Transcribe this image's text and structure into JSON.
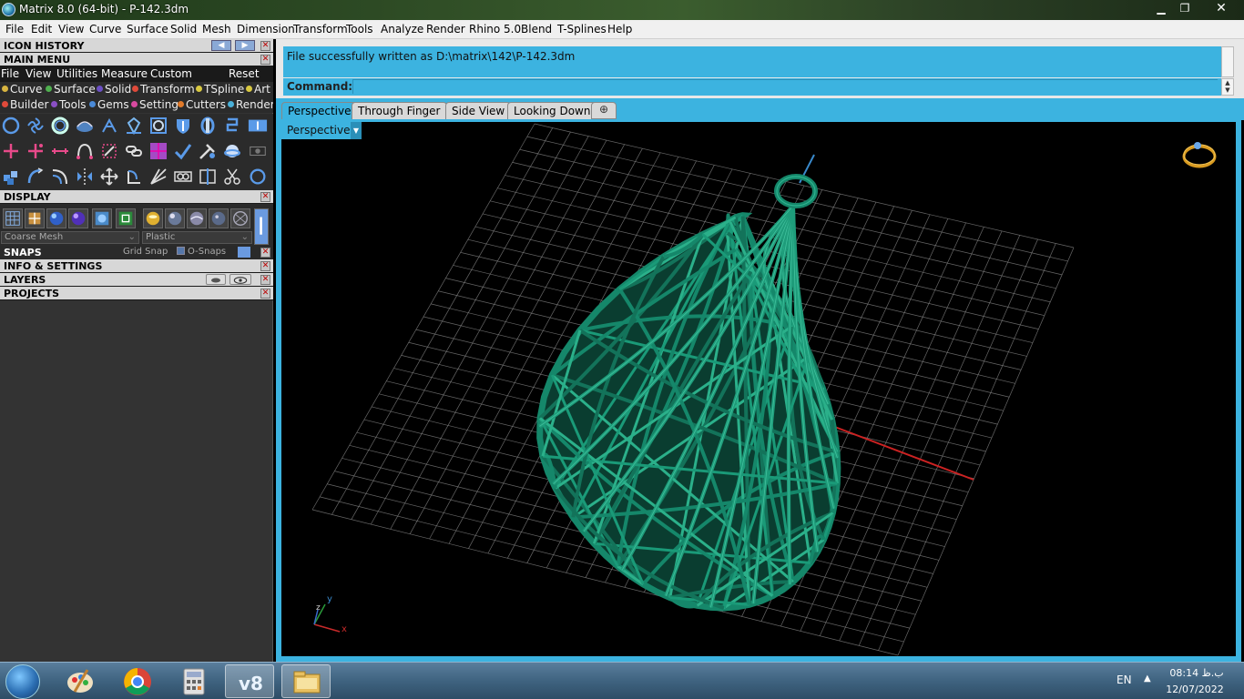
{
  "window": {
    "title": "Matrix 8.0 (64-bit) - P-142.3dm",
    "minimize": "▁",
    "maximize": "❐",
    "close": "✕"
  },
  "menubar": [
    "File",
    "Edit",
    "View",
    "Curve",
    "Surface",
    "Solid",
    "Mesh",
    "Dimension",
    "Transform",
    "Tools",
    "Analyze",
    "Render",
    "Rhino 5.0",
    "Blend",
    "T-Splines",
    "Help"
  ],
  "left_panel": {
    "icon_history": "ICON HISTORY",
    "main_menu": "MAIN MENU",
    "main_menu_items": [
      "File",
      "View",
      "Utilities",
      "Measure",
      "Custom",
      "Reset"
    ],
    "categories_row1": [
      {
        "label": "Curve",
        "color": "#d8b440"
      },
      {
        "label": "Surface",
        "color": "#4fb04f"
      },
      {
        "label": "Solid",
        "color": "#6b4fc4"
      },
      {
        "label": "Transform",
        "color": "#e04a3a"
      },
      {
        "label": "TSpline",
        "color": "#d8c840"
      },
      {
        "label": "Art",
        "color": "#d8c840"
      }
    ],
    "categories_row2": [
      {
        "label": "Builder",
        "color": "#e04a3a"
      },
      {
        "label": "Tools",
        "color": "#8a4fc4"
      },
      {
        "label": "Gems",
        "color": "#4a8ad8"
      },
      {
        "label": "Setting",
        "color": "#d84aa0"
      },
      {
        "label": "Cutters",
        "color": "#e07a2a"
      },
      {
        "label": "Render",
        "color": "#4ab0d8"
      }
    ],
    "display": "DISPLAY",
    "mesh_select": "Coarse Mesh",
    "material_select": "Plastic",
    "snaps": "SNAPS",
    "grid_snap": "Grid Snap",
    "osnaps": "O-Snaps",
    "info_settings": "INFO & SETTINGS",
    "layers": "LAYERS",
    "projects": "PROJECTS",
    "nav_left": "◀",
    "nav_right": "▶",
    "close_x": "✕"
  },
  "command": {
    "history_text": "File successfully written as D:\\matrix\\142\\P-142.3dm",
    "label": "Command:",
    "value": ""
  },
  "tabs": [
    "Perspective",
    "Through Finger",
    "Side View",
    "Looking Down"
  ],
  "tab_add": "⊕",
  "viewport": {
    "label": "Perspective",
    "drop": "▼",
    "axis_x": "x",
    "axis_y": "y",
    "axis_z": "z"
  },
  "taskbar": {
    "lang": "EN",
    "tray_arrow": "▲",
    "time": "08:14 ب.ظ",
    "date": "12/07/2022"
  },
  "colors": {
    "accent": "#3cb3e0",
    "model": "#15876a"
  }
}
